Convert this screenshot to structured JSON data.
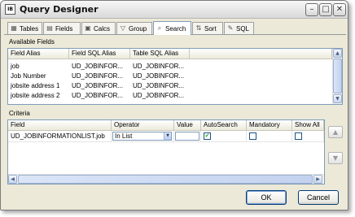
{
  "window": {
    "title": "Query Designer",
    "icon_label": "IB"
  },
  "titlebar_buttons": {
    "minimize": "–",
    "maximize": "□",
    "close": "✕"
  },
  "tabs": [
    {
      "label": "Tables",
      "icon": "table-icon"
    },
    {
      "label": "Fields",
      "icon": "document-icon"
    },
    {
      "label": "Calcs",
      "icon": "calculator-icon"
    },
    {
      "label": "Group",
      "icon": "funnel-icon"
    },
    {
      "label": "Search",
      "icon": "magnifier-icon"
    },
    {
      "label": "Sort",
      "icon": "sort-az-icon"
    },
    {
      "label": "SQL",
      "icon": "sql-icon"
    }
  ],
  "active_tab": "Search",
  "available_fields": {
    "section_label": "Available Fields",
    "columns": [
      "Field Alias",
      "Field SQL Alias",
      "Table SQL Alias"
    ],
    "rows": [
      [
        "job",
        "UD_JOBINFOR...",
        "UD_JOBINFOR..."
      ],
      [
        "Job Number",
        "UD_JOBINFOR...",
        "UD_JOBINFOR..."
      ],
      [
        "jobsite address 1",
        "UD_JOBINFOR...",
        "UD_JOBINFOR..."
      ],
      [
        "jobsite address 2",
        "UD_JOBINFOR...",
        "UD_JOBINFOR..."
      ]
    ]
  },
  "criteria": {
    "section_label": "Criteria",
    "columns": [
      "Field",
      "Operator",
      "Value",
      "AutoSearch",
      "Mandatory",
      "Show All"
    ],
    "rows": [
      {
        "field": "UD_JOBINFORMATIONLIST.job",
        "operator": "In List",
        "value": "",
        "autosearch": true,
        "mandatory": false,
        "show_all": false
      }
    ]
  },
  "side_buttons": {
    "up": "▲",
    "down": "▼"
  },
  "buttons": {
    "ok": "OK",
    "cancel": "Cancel"
  }
}
